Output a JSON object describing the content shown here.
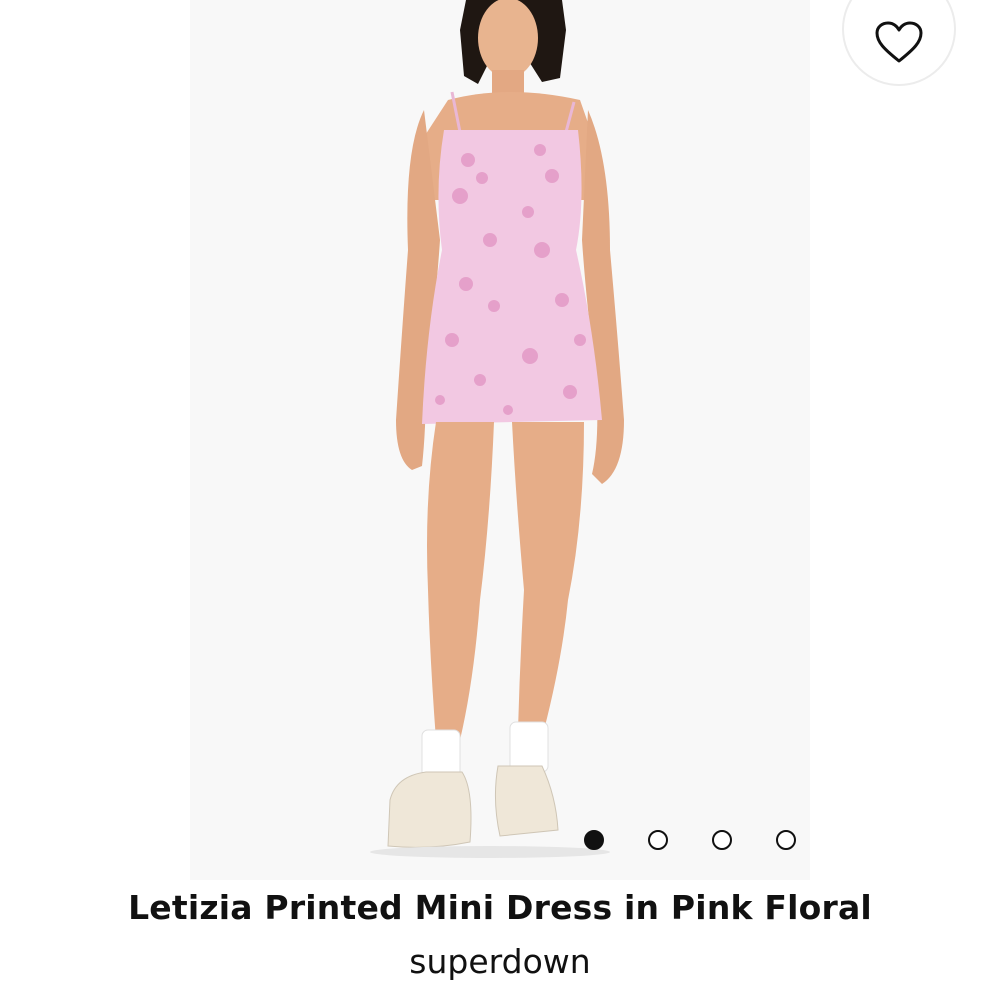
{
  "product": {
    "title": "Letizia Printed Mini Dress in Pink Floral",
    "brand": "superdown",
    "image_alt": "Model wearing pink floral satin mini dress with white socks and sneakers"
  },
  "favorite": {
    "icon": "heart-outline-icon",
    "state": "not-favorited"
  },
  "carousel": {
    "total_images": 4,
    "active_index": 0
  },
  "colors": {
    "dress_pink": "#f2c8e2",
    "text": "#111111",
    "dot_active": "#111111"
  }
}
